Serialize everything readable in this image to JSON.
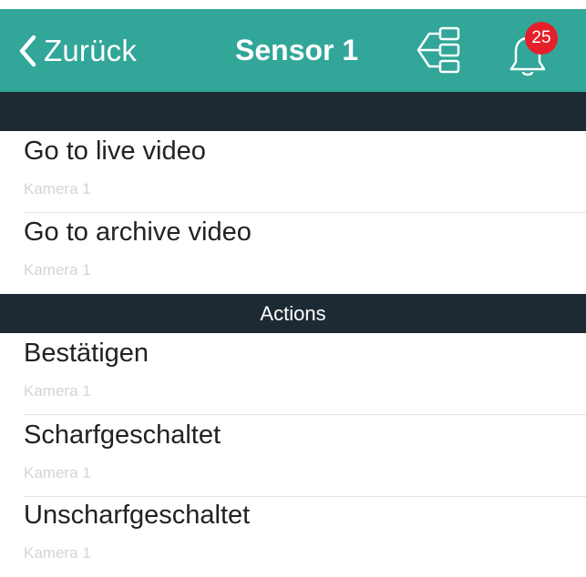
{
  "navbar": {
    "back_label": "Zurück",
    "title": "Sensor 1",
    "notification_count": "25",
    "icons": [
      "chevron-left-icon",
      "tree-structure-icon",
      "bell-icon"
    ],
    "colors": {
      "navbar_bg": "#31a699",
      "badge": "#e5202a",
      "header_bg": "#1e2a33"
    }
  },
  "sections": [
    {
      "title": "",
      "items": [
        {
          "title": "Go to live video",
          "subtitle": "Kamera 1"
        },
        {
          "title": "Go to archive video",
          "subtitle": "Kamera 1"
        }
      ]
    },
    {
      "title": "Actions",
      "items": [
        {
          "title": "Bestätigen",
          "subtitle": "Kamera 1"
        },
        {
          "title": "Scharfgeschaltet",
          "subtitle": "Kamera 1"
        },
        {
          "title": "Unscharfgeschaltet",
          "subtitle": "Kamera 1"
        }
      ]
    }
  ]
}
